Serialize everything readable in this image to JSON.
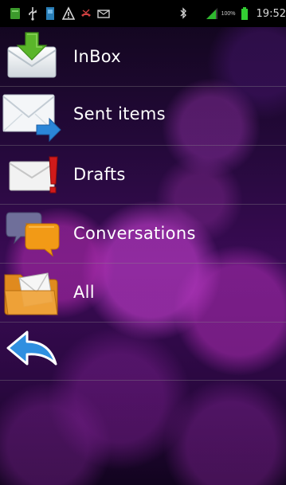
{
  "status_bar": {
    "battery_percent": "100%",
    "time": "19:52",
    "icons": [
      "app-notification-icon",
      "usb-icon",
      "sim-icon",
      "warning-icon",
      "missed-call-icon",
      "mail-icon",
      "bluetooth-icon",
      "signal-icon",
      "battery-icon"
    ]
  },
  "menu": {
    "items": [
      {
        "label": "InBox",
        "icon": "inbox-download-icon"
      },
      {
        "label": "Sent items",
        "icon": "sent-envelope-arrow-icon"
      },
      {
        "label": "Drafts",
        "icon": "drafts-envelope-icon"
      },
      {
        "label": "Conversations",
        "icon": "conversation-bubbles-icon"
      },
      {
        "label": "All",
        "icon": "folder-mail-icon"
      }
    ],
    "back_icon": "back-arrow-icon"
  },
  "colors": {
    "text": "#ffffff",
    "background_top": "#10061b",
    "background_purple": "#3a0b55",
    "bokeh_magenta": "#be3cc8",
    "divider": "#8c8c8c",
    "battery_green": "#33cc33",
    "back_arrow_blue": "#2f8fe0"
  }
}
